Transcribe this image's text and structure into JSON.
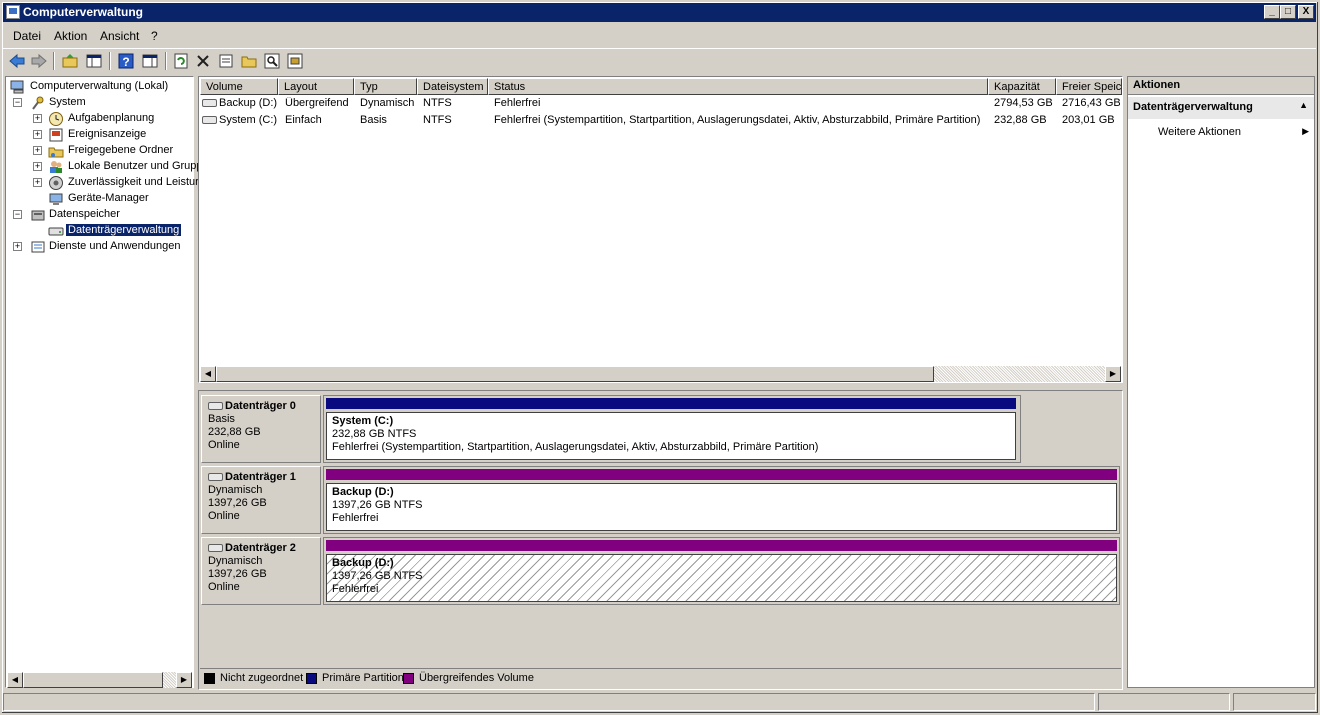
{
  "window": {
    "title": "Computerverwaltung"
  },
  "caption_buttons": {
    "minimize": "_",
    "maximize": "□",
    "close": "X"
  },
  "menu": [
    "Datei",
    "Aktion",
    "Ansicht",
    "?"
  ],
  "toolbar": [
    "back-icon",
    "forward-icon",
    "up-folder-icon",
    "show-hide-tree-icon",
    "help-icon",
    "properties-view-icon",
    "refresh-icon",
    "delete-icon",
    "properties-icon",
    "open-icon",
    "search-icon",
    "disk-settings-icon"
  ],
  "tree": {
    "root": "Computerverwaltung (Lokal)",
    "system": "System",
    "aufgaben": "Aufgabenplanung",
    "ereignis": "Ereignisanzeige",
    "freigegeben": "Freigegebene Ordner",
    "benutzer": "Lokale Benutzer und Grupp",
    "zuverl": "Zuverlässigkeit und Leistur",
    "geraete": "Geräte-Manager",
    "datenspeicher": "Datenspeicher",
    "dtv": "Datenträgerverwaltung",
    "dienste": "Dienste und Anwendungen",
    "expander_plus": "+",
    "expander_minus": "−"
  },
  "volume_list": {
    "columns": [
      "Volume",
      "Layout",
      "Typ",
      "Dateisystem",
      "Status",
      "Kapazität",
      "Freier Speic"
    ],
    "rows": [
      [
        "Backup (D:)",
        "Übergreifend",
        "Dynamisch",
        "NTFS",
        "Fehlerfrei",
        "2794,53 GB",
        "2716,43 GB"
      ],
      [
        "System (C:)",
        "Einfach",
        "Basis",
        "NTFS",
        "Fehlerfrei (Systempartition, Startpartition, Auslagerungsdatei, Aktiv, Absturzabbild, Primäre Partition)",
        "232,88 GB",
        "203,01 GB"
      ]
    ]
  },
  "disks": [
    {
      "name": "Datenträger 0",
      "type": "Basis",
      "size": "232,88 GB",
      "state": "Online",
      "volume": {
        "name": "System  (C:)",
        "size": "232,88 GB NTFS",
        "status": "Fehlerfrei (Systempartition, Startpartition, Auslagerungsdatei, Aktiv, Absturzabbild, Primäre Partition)",
        "bar_color": "#0a0a80"
      }
    },
    {
      "name": "Datenträger 1",
      "type": "Dynamisch",
      "size": "1397,26 GB",
      "state": "Online",
      "volume": {
        "name": "Backup  (D:)",
        "size": "1397,26 GB NTFS",
        "status": "Fehlerfrei",
        "bar_color": "#800080"
      }
    },
    {
      "name": "Datenträger 2",
      "type": "Dynamisch",
      "size": "1397,26 GB",
      "state": "Online",
      "volume": {
        "name": "Backup  (D:)",
        "size": "1397,26 GB NTFS",
        "status": "Fehlerfrei",
        "bar_color": "#800080"
      }
    }
  ],
  "legend": [
    {
      "label": "Nicht zugeordnet",
      "color": "#000000"
    },
    {
      "label": "Primäre Partition",
      "color": "#0a0a80"
    },
    {
      "label": "Übergreifendes Volume",
      "color": "#800080"
    }
  ],
  "actions": {
    "title": "Aktionen",
    "section": "Datenträgerverwaltung",
    "item": "Weitere Aktionen"
  }
}
